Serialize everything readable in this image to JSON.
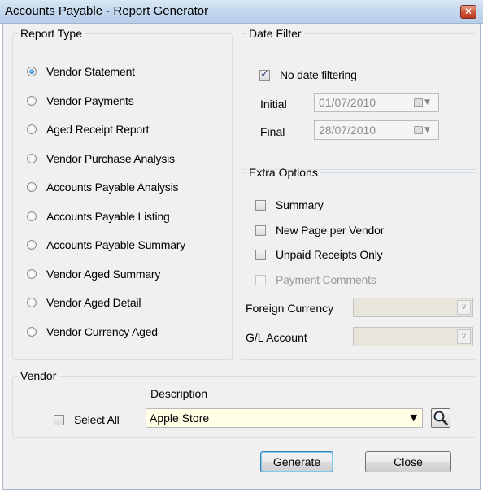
{
  "window": {
    "title": "Accounts Payable - Report Generator",
    "close_glyph": "✕"
  },
  "report_type": {
    "legend": "Report Type",
    "options": [
      {
        "label": "Vendor Statement",
        "selected": true
      },
      {
        "label": "Vendor Payments",
        "selected": false
      },
      {
        "label": "Aged Receipt Report",
        "selected": false
      },
      {
        "label": "Vendor Purchase Analysis",
        "selected": false
      },
      {
        "label": "Accounts Payable Analysis",
        "selected": false
      },
      {
        "label": "Accounts Payable Listing",
        "selected": false
      },
      {
        "label": "Accounts Payable Summary",
        "selected": false
      },
      {
        "label": "Vendor Aged Summary",
        "selected": false
      },
      {
        "label": "Vendor Aged Detail",
        "selected": false
      },
      {
        "label": "Vendor Currency Aged",
        "selected": false
      }
    ]
  },
  "date_filter": {
    "legend": "Date Filter",
    "no_date_label": "No date filtering",
    "no_date_checked": true,
    "initial_label": "Initial",
    "initial_value": "01/07/2010",
    "final_label": "Final",
    "final_value": "28/07/2010",
    "dropdown_glyph": "▼"
  },
  "extra_options": {
    "legend": "Extra Options",
    "summary_label": "Summary",
    "new_page_label": "New Page per Vendor",
    "unpaid_label": "Unpaid Receipts Only",
    "payment_comments_label": "Payment Comments",
    "foreign_currency_label": "Foreign Currency",
    "gl_account_label": "G/L Account",
    "combo_glyph": "∨"
  },
  "vendor": {
    "legend": "Vendor",
    "description_header": "Description",
    "select_all_label": "Select All",
    "description_value": "Apple Store",
    "dropdown_glyph": "▼"
  },
  "buttons": {
    "generate": "Generate",
    "close": "Close"
  }
}
